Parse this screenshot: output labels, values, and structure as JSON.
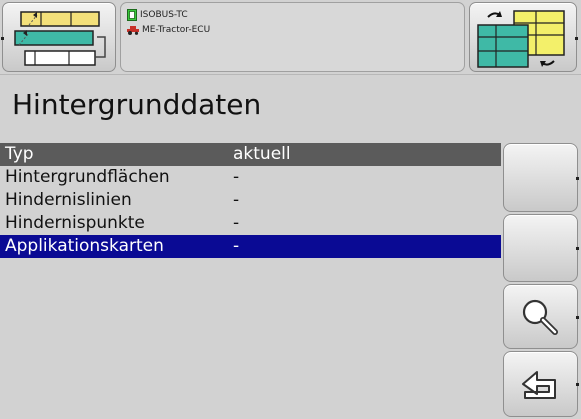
{
  "status": {
    "isobus_tc": "ISOBUS-TC",
    "ecu": "ME-Tractor-ECU"
  },
  "page": {
    "title": "Hintergrunddaten"
  },
  "table": {
    "columns": [
      "Typ",
      "aktuell"
    ],
    "rows": [
      {
        "type": "Hintergrundflächen",
        "current": "-"
      },
      {
        "type": "Hindernislinien",
        "current": "-"
      },
      {
        "type": "Hindernispunkte",
        "current": "-"
      },
      {
        "type": "Applikationskarten",
        "current": "-",
        "selected": true
      }
    ]
  },
  "buttons": {
    "top_left_icon": "field-boundary-map-icon",
    "top_right_icon": "layer-switch-icon",
    "side": [
      "empty-button",
      "empty-button",
      "magnifier-icon",
      "back-return-icon"
    ]
  },
  "colors": {
    "background": "#d2d2d2",
    "header": "#5b5b5b",
    "selection": "#0a0a94"
  }
}
